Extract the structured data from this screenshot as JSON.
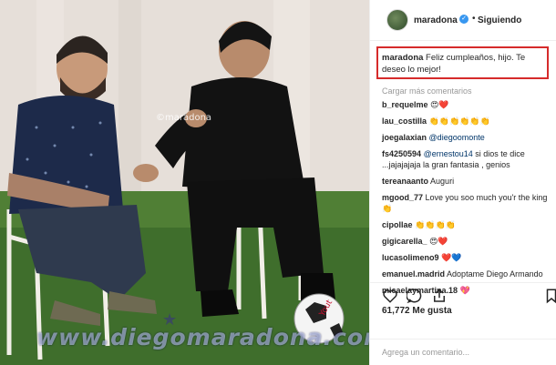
{
  "header": {
    "username": "maradona",
    "separator": "•",
    "follow_label": "Siguiendo"
  },
  "caption": {
    "username": "maradona",
    "text": "Feliz cumpleaños, hijo. Te deseo lo mejor!"
  },
  "load_more": "Cargar más comentarios",
  "comments": [
    {
      "user": "b_requelme",
      "text": "😍❤️"
    },
    {
      "user": "lau_costilla",
      "text": "👏👏👏👏👏👏"
    },
    {
      "user": "joegalaxian",
      "mention": "@diegoomonte",
      "text": ""
    },
    {
      "user": "fs4250594",
      "mention": "@ernestou14",
      "text": "si dios te dice ...jajajajaja la gran fantasia , genios"
    },
    {
      "user": "tereanaanto",
      "text": "Auguri"
    },
    {
      "user": "mgood_77",
      "text": "Love you soo much you'r the king 👏"
    },
    {
      "user": "cipollae",
      "text": "👏👏👏👏"
    },
    {
      "user": "gigicarella_",
      "text": "😍❤️"
    },
    {
      "user": "lucasolimeno9",
      "text": "❤️💙"
    },
    {
      "user": "emanuel.madrid",
      "text": "Adoptame Diego Armando"
    },
    {
      "user": "micaelaymartina.18",
      "text": "💖"
    }
  ],
  "likes": "61,772 Me gusta",
  "add_comment_placeholder": "Agrega un comentario...",
  "watermark_small": "©maradona",
  "watermark_big": "www.diegomaradona.com",
  "colors": {
    "highlight_border": "#d62b2b",
    "verified": "#3897f0",
    "mention": "#003569"
  }
}
